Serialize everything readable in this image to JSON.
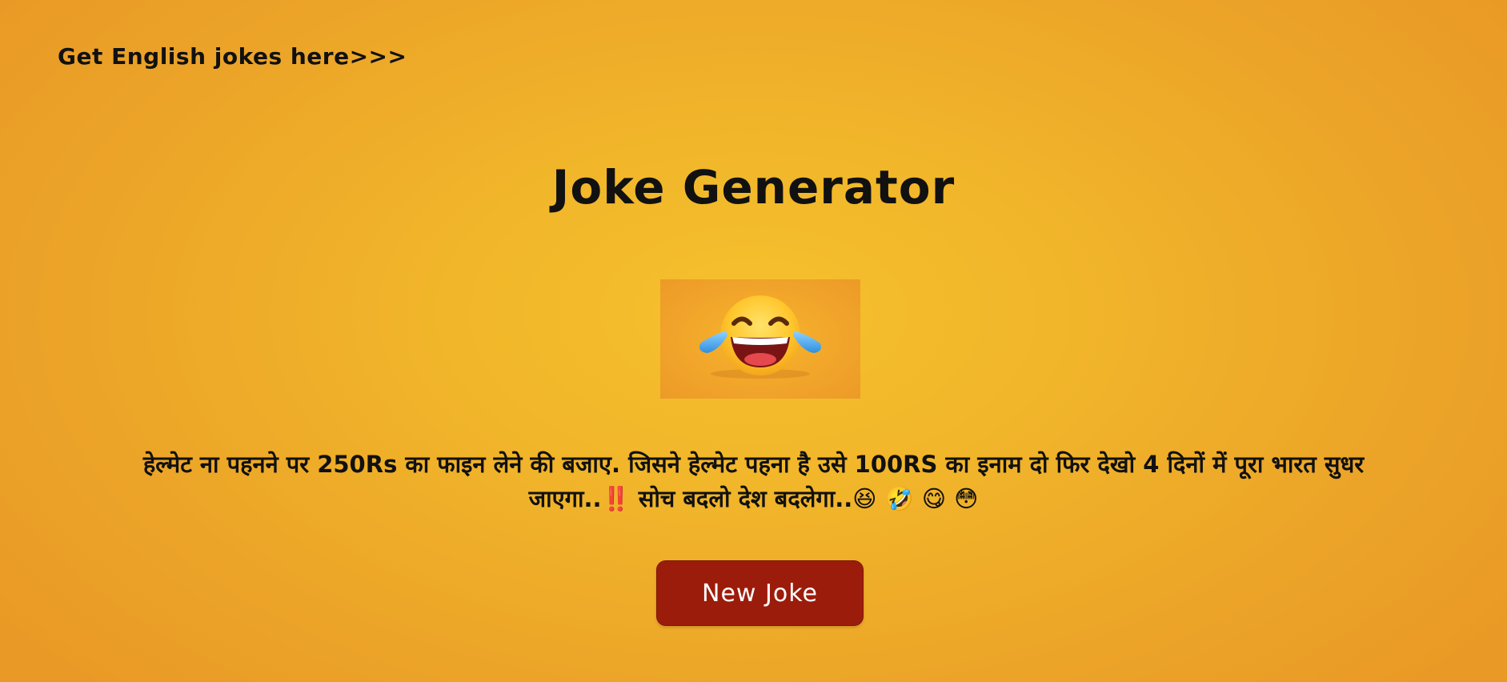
{
  "header": {
    "english_link_text": "Get English jokes here>>>"
  },
  "main": {
    "title": "Joke Generator",
    "image_icon": "laughing-with-tears-emoji-icon",
    "joke_text": "हेल्मेट ना पहनने पर 250Rs का फाइन लेने की बजाए. जिसने हेल्मेट पहना है उसे 100RS का इनाम दो फिर देखो 4 दिनों में पूरा भारत सुधर जाएगा..‼️ सोच बदलो देश बदलेगा..😆 🤣 😋 😳",
    "button_label": "New Joke"
  },
  "colors": {
    "background_center": "#f5c12d",
    "background_edge": "#e99a26",
    "button_bg": "#9c1c0c",
    "button_text": "#ffffff",
    "text": "#111111"
  }
}
